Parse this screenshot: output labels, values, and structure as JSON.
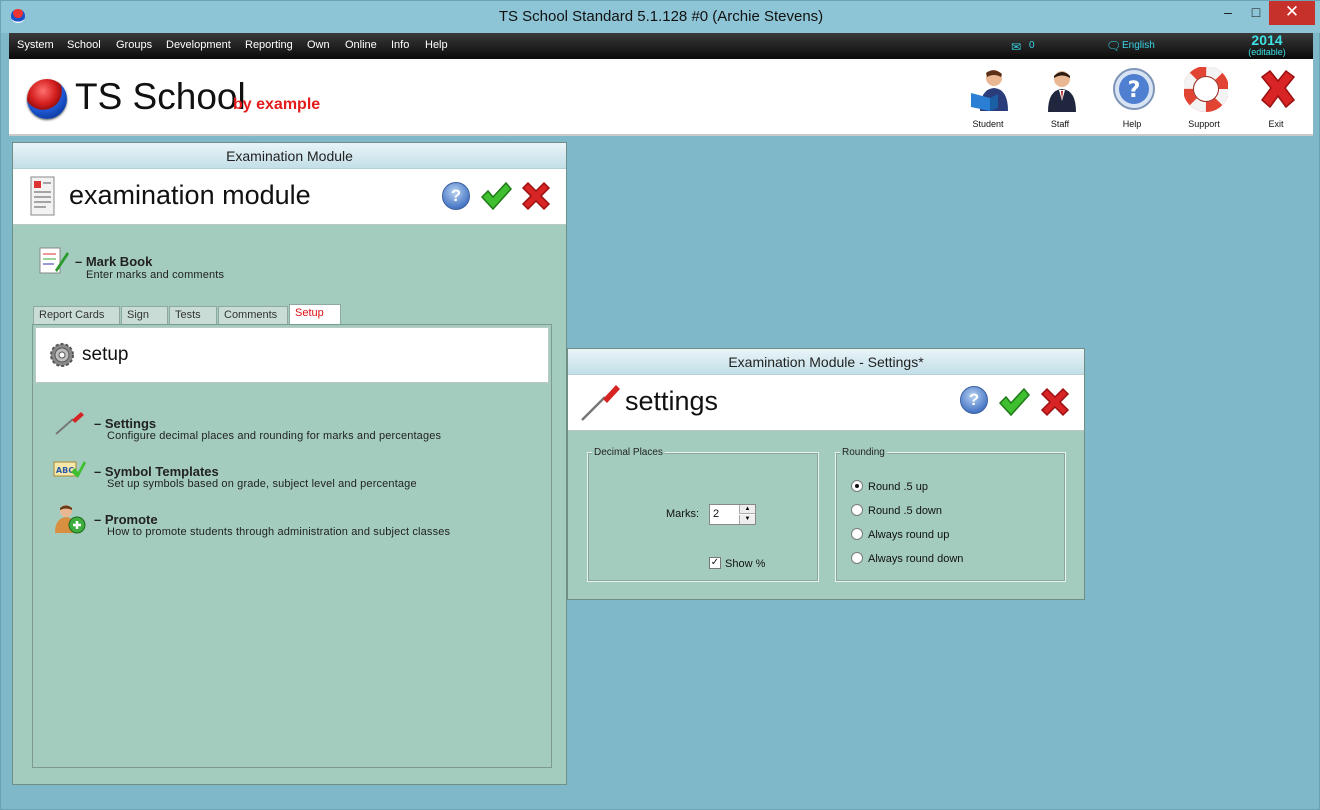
{
  "window": {
    "title": "TS School Standard 5.1.128 #0 (Archie Stevens)",
    "minimize": "–",
    "maximize": "□",
    "close": "✕"
  },
  "menu": {
    "items": [
      "System",
      "School",
      "Groups",
      "Development",
      "Reporting",
      "Own",
      "Online",
      "Info",
      "Help"
    ],
    "mail_count": "0",
    "language": "English",
    "year": "2014",
    "year_note": "(editable)"
  },
  "header": {
    "logo_text": "TS School",
    "logo_sub": "by example",
    "toolbar": [
      "Student",
      "Staff",
      "Help",
      "Support",
      "Exit"
    ]
  },
  "exam_panel": {
    "window_title": "Examination Module",
    "heading": "examination module",
    "help_glyph": "?",
    "mark_book": {
      "title": "Mark Book",
      "desc": "Enter marks and comments"
    },
    "tabs": [
      "Report Cards",
      "Sign",
      "Tests",
      "Comments",
      "Setup"
    ],
    "active_tab": "Setup",
    "setup_heading": "setup",
    "items": [
      {
        "title": "Settings",
        "desc": "Configure decimal places and rounding for marks and percentages"
      },
      {
        "title": "Symbol Templates",
        "desc": "Set up symbols based on grade, subject level and percentage"
      },
      {
        "title": "Promote",
        "desc": "How to promote students through administration and subject classes"
      }
    ]
  },
  "settings_panel": {
    "window_title": "Examination Module - Settings*",
    "heading": "settings",
    "help_glyph": "?",
    "decimal_places": {
      "label": "Decimal Places",
      "marks_label": "Marks:",
      "marks_value": "2",
      "show_percent_label": "Show %",
      "show_percent_checked": true
    },
    "rounding": {
      "label": "Rounding",
      "options": [
        "Round .5 up",
        "Round .5 down",
        "Always round up",
        "Always round down"
      ],
      "selected": "Round .5 up"
    }
  },
  "colors": {
    "panel_bg": "#a3ccbf",
    "desktop_bg": "#93b9ab",
    "accent_red": "#e31b1b",
    "menu_text_cyan": "#37d4e6"
  }
}
